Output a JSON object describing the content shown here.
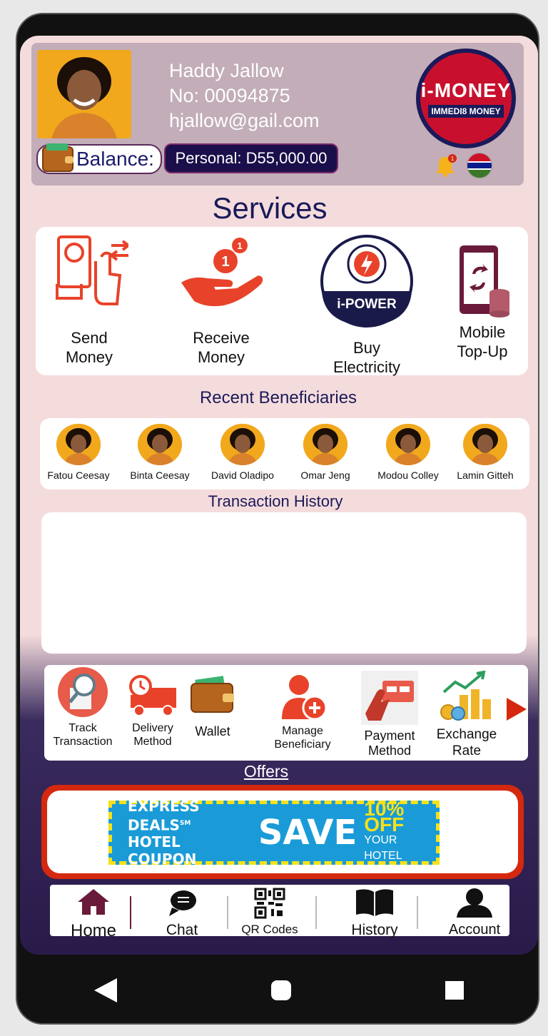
{
  "profile": {
    "name": "Haddy Jallow",
    "number": "No: 00094875",
    "email": "hjallow@gail.com",
    "balance_label": "Balance:",
    "balance_value": "Personal: D55,000.00",
    "logo_title": "i-MONEY",
    "logo_subtitle": "IMMEDI8 MONEY",
    "notification_count": "1"
  },
  "services": {
    "title": "Services",
    "items": [
      {
        "label_line1": "Send",
        "label_line2": "Money",
        "icon": "send-money-icon"
      },
      {
        "label_line1": "Receive",
        "label_line2": "Money",
        "icon": "receive-money-icon"
      },
      {
        "label_line1": "Buy",
        "label_line2": "Electricity",
        "icon": "i-power-icon",
        "badge": "i-POWER"
      },
      {
        "label_line1": "Mobile",
        "label_line2": "Top-Up",
        "icon": "mobile-topup-icon"
      }
    ]
  },
  "beneficiaries": {
    "title": "Recent Beneficiaries",
    "items": [
      "Fatou Ceesay",
      "Binta Ceesay",
      "David Oladipo",
      "Omar Jeng",
      "Modou Colley",
      "Lamin Gitteh"
    ]
  },
  "transaction_history": {
    "title": "Transaction History"
  },
  "quick_actions": [
    {
      "line1": "Track",
      "line2": "Transaction",
      "icon": "track-transaction-icon"
    },
    {
      "line1": "Delivery",
      "line2": "Method",
      "icon": "delivery-truck-icon"
    },
    {
      "line1": "Wallet",
      "line2": "",
      "icon": "wallet-icon"
    },
    {
      "line1": "Manage",
      "line2": "Beneficiary",
      "icon": "add-user-icon"
    },
    {
      "line1": "Payment",
      "line2": "Method",
      "icon": "payment-card-icon"
    },
    {
      "line1": "Exchange",
      "line2": "Rate",
      "icon": "exchange-rate-icon"
    }
  ],
  "offers": {
    "title": "Offers",
    "banner_line1": "EXPRESS DEALS",
    "banner_sm": "SM",
    "banner_line2": "HOTEL COUPON",
    "banner_save": "SAVE",
    "banner_pct": "10% OFF",
    "banner_sub": "YOUR HOTEL"
  },
  "bottom_nav": [
    {
      "label": "Home",
      "icon": "home-icon"
    },
    {
      "label": "Chat",
      "icon": "chat-icon"
    },
    {
      "label": "QR Codes",
      "icon": "qr-code-icon"
    },
    {
      "label": "History",
      "icon": "book-icon"
    },
    {
      "label": "Account",
      "icon": "account-icon"
    }
  ],
  "colors": {
    "accent_red": "#e8432a",
    "navy": "#1a1a5a",
    "header_bg": "#c2adb9",
    "screen_bg": "#f5dcdc"
  }
}
